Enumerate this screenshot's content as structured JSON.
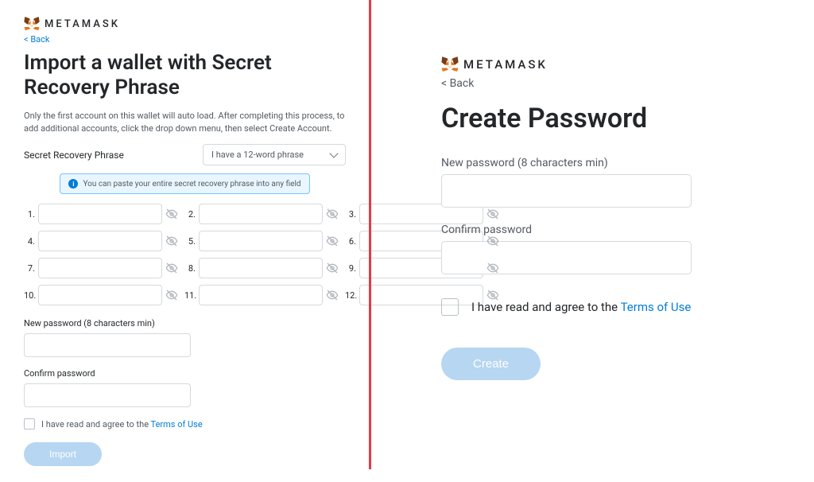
{
  "brand": "METAMASK",
  "back_label": "< Back",
  "left": {
    "title": "Import a wallet with Secret Recovery Phrase",
    "subtext": "Only the first account on this wallet will auto load. After completing this process, to add additional accounts, click the drop down menu, then select Create Account.",
    "srp_label": "Secret Recovery Phrase",
    "phrase_selector": "I have a 12-word phrase",
    "info_text": "You can paste your entire secret recovery phrase into any field",
    "words": [
      "1.",
      "2.",
      "3.",
      "4.",
      "5.",
      "6.",
      "7.",
      "8.",
      "9.",
      "10.",
      "11.",
      "12."
    ],
    "new_password_label": "New password (8 characters min)",
    "confirm_password_label": "Confirm password",
    "terms_text": "I have read and agree to the ",
    "terms_link": "Terms of Use",
    "import_btn": "Import"
  },
  "right": {
    "title": "Create Password",
    "new_password_label": "New password (8 characters min)",
    "confirm_password_label": "Confirm password",
    "terms_text": "I have read and agree to the ",
    "terms_link": "Terms of Use",
    "create_btn": "Create"
  }
}
